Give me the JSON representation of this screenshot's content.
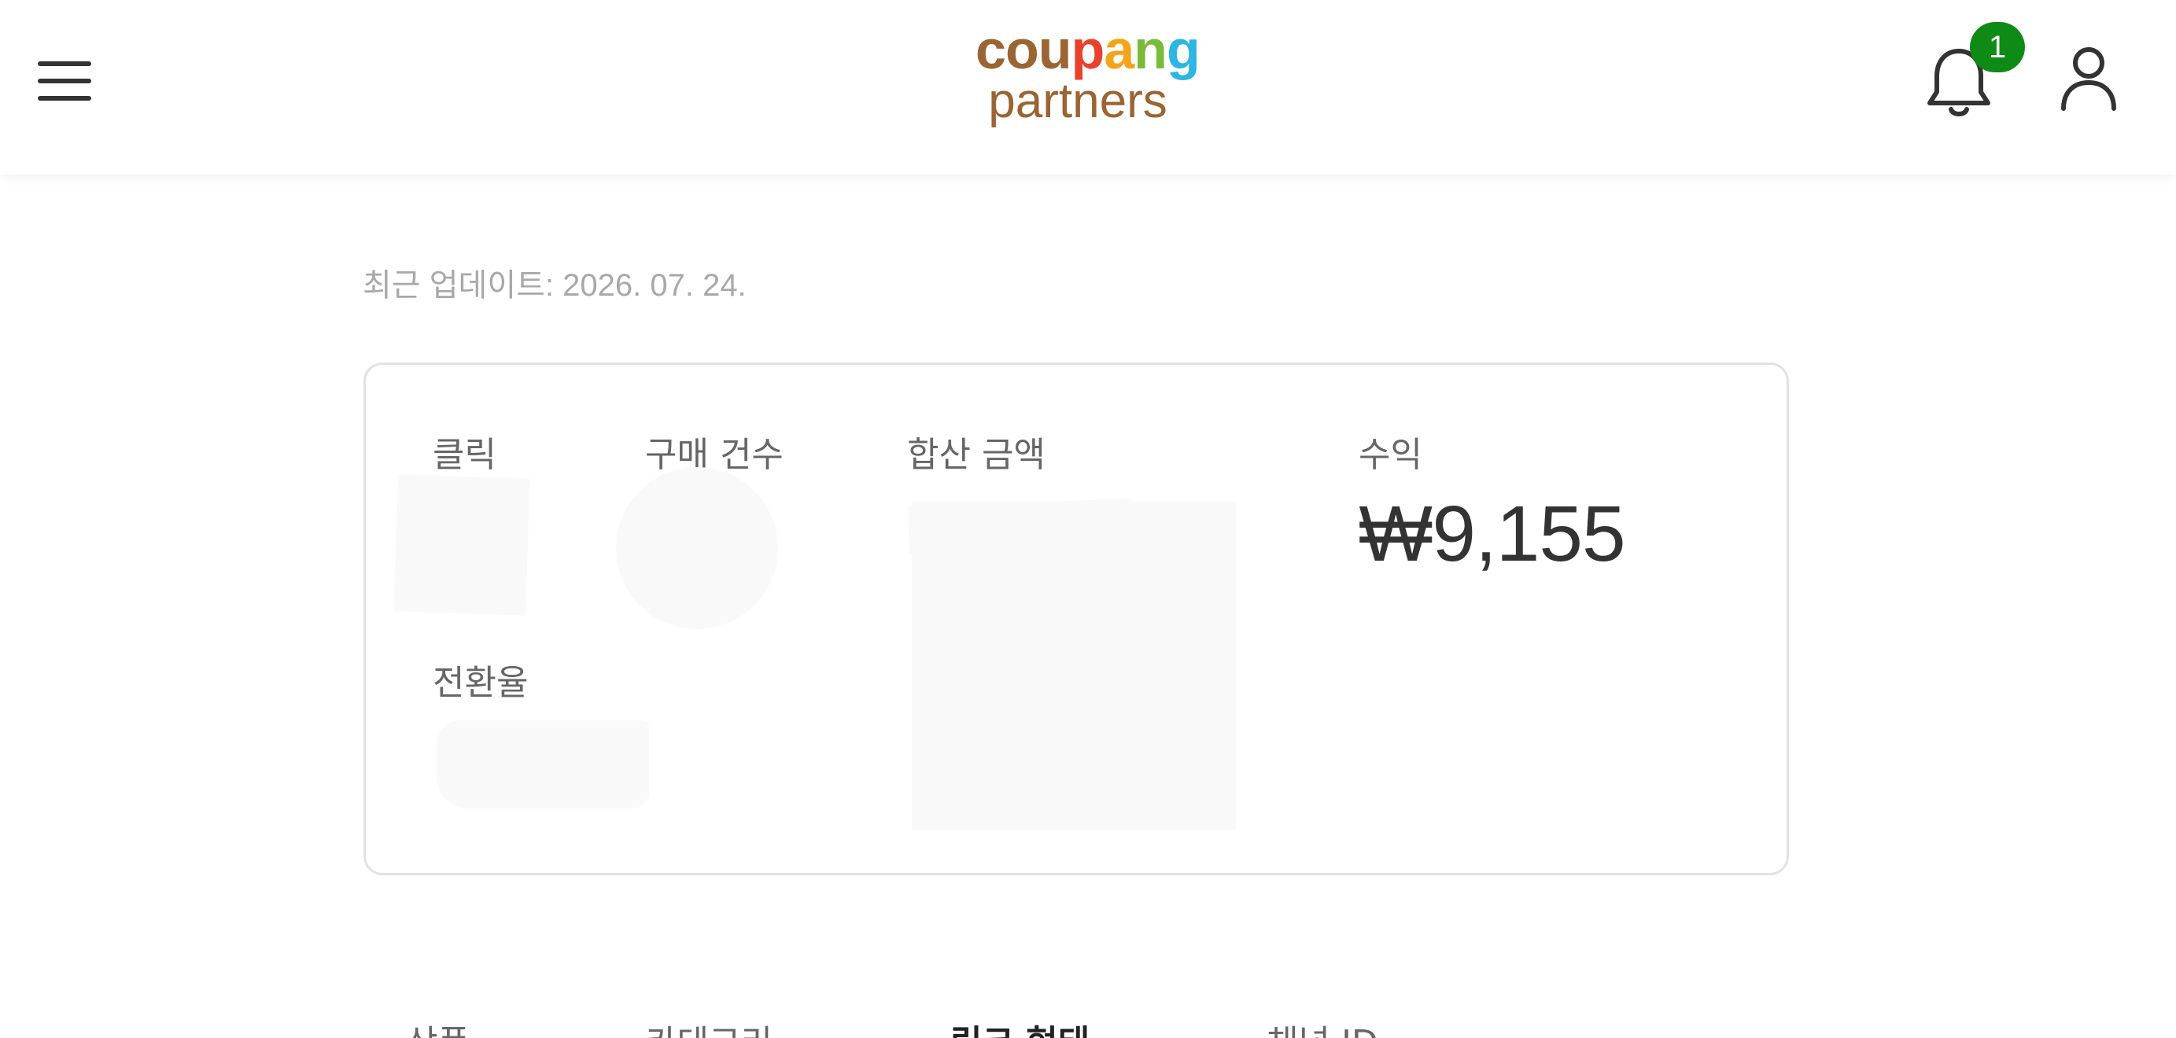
{
  "header": {
    "logo": {
      "top_letters": [
        {
          "ch": "c",
          "color": "#9a6433"
        },
        {
          "ch": "o",
          "color": "#9a6433"
        },
        {
          "ch": "u",
          "color": "#9a6433"
        },
        {
          "ch": "p",
          "color": "#e8412c"
        },
        {
          "ch": "a",
          "color": "#f2a51b"
        },
        {
          "ch": "n",
          "color": "#7cba3b"
        },
        {
          "ch": "g",
          "color": "#2db5e3"
        }
      ],
      "bottom": "partners"
    },
    "notification_count": "1",
    "icons": {
      "menu": "hamburger-menu-icon",
      "bell": "bell-icon",
      "user": "user-icon"
    }
  },
  "main": {
    "last_update": "최근 업데이트: 2026. 07. 24.",
    "stats": {
      "clicks_label": "클릭",
      "purchases_label": "구매 건수",
      "total_amount_label": "합산 금액",
      "earnings_label": "수익",
      "earnings_value": "₩9,155",
      "conversion_label": "전환율"
    }
  },
  "tabs": [
    "상품",
    "카테고리",
    "링크 형태",
    "채널 ID"
  ],
  "active_tab_index": 2,
  "colors": {
    "badge": "#0e8a16",
    "border": "#e2e2e2",
    "muted_text": "#a8a8a8"
  }
}
